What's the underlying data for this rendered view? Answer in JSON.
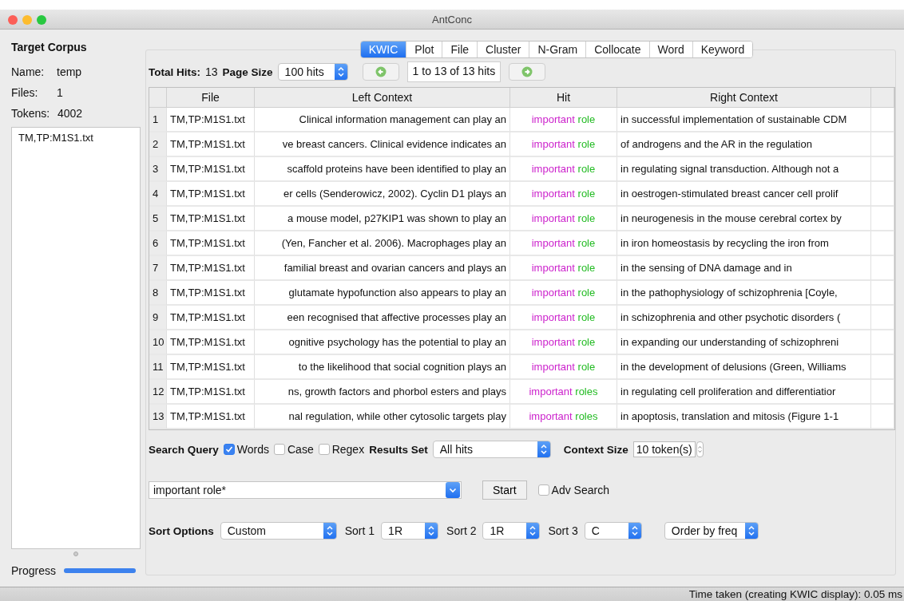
{
  "window": {
    "title": "AntConc"
  },
  "sidebar": {
    "heading": "Target Corpus",
    "stats": [
      {
        "label": "Name:",
        "value": "temp"
      },
      {
        "label": "Files:",
        "value": "1"
      },
      {
        "label": "Tokens:",
        "value": "4002"
      }
    ],
    "files": [
      {
        "name": "TM,TP:M1S1.txt",
        "selected": false
      }
    ],
    "progress": {
      "label": "Progress",
      "level": 1
    }
  },
  "tabs": [
    {
      "label": "KWIC",
      "selected": true
    },
    {
      "label": "Plot",
      "selected": false
    },
    {
      "label": "File",
      "selected": false
    },
    {
      "label": "Cluster",
      "selected": false
    },
    {
      "label": "N-Gram",
      "selected": false
    },
    {
      "label": "Collocate",
      "selected": false
    },
    {
      "label": "Word",
      "selected": false
    },
    {
      "label": "Keyword",
      "selected": false
    }
  ],
  "toolbar": {
    "total_hits_label": "Total Hits:",
    "total_hits": "13",
    "page_size_label": "Page Size",
    "page_size": "100 hits",
    "range": "1 to 13 of 13 hits"
  },
  "table": {
    "columns": [
      "File",
      "Left Context",
      "Hit",
      "Right Context"
    ],
    "rows": [
      {
        "number": "1",
        "file": "TM,TP:M1S1.txt",
        "left": "Clinical information management can play an",
        "hit": [
          {
            "text": "important",
            "color": "#cc22cc"
          },
          {
            "text": "role",
            "color": "#22bb22"
          }
        ],
        "right": "in successful implementation of sustainable CDM"
      },
      {
        "number": "2",
        "file": "TM,TP:M1S1.txt",
        "left": "ve breast cancers. Clinical evidence indicates an",
        "hit": [
          {
            "text": "important",
            "color": "#cc22cc"
          },
          {
            "text": "role",
            "color": "#22bb22"
          }
        ],
        "right": "of androgens and the AR in the regulation"
      },
      {
        "number": "3",
        "file": "TM,TP:M1S1.txt",
        "left": "scaffold proteins have been identified to play an",
        "hit": [
          {
            "text": "important",
            "color": "#cc22cc"
          },
          {
            "text": "role",
            "color": "#22bb22"
          }
        ],
        "right": "in regulating signal transduction. Although not a"
      },
      {
        "number": "4",
        "file": "TM,TP:M1S1.txt",
        "left": "er cells (Senderowicz, 2002). Cyclin D1 plays an",
        "hit": [
          {
            "text": "important",
            "color": "#cc22cc"
          },
          {
            "text": "role",
            "color": "#22bb22"
          }
        ],
        "right": "in oestrogen-stimulated breast cancer cell prolif"
      },
      {
        "number": "5",
        "file": "TM,TP:M1S1.txt",
        "left": "a mouse model, p27KIP1 was shown to play an",
        "hit": [
          {
            "text": "important",
            "color": "#cc22cc"
          },
          {
            "text": "role",
            "color": "#22bb22"
          }
        ],
        "right": "in neurogenesis in the mouse cerebral cortex by"
      },
      {
        "number": "6",
        "file": "TM,TP:M1S1.txt",
        "left": "(Yen, Fancher et al. 2006). Macrophages play an",
        "hit": [
          {
            "text": "important",
            "color": "#cc22cc"
          },
          {
            "text": "role",
            "color": "#22bb22"
          }
        ],
        "right": "in iron homeostasis by recycling the iron from"
      },
      {
        "number": "7",
        "file": "TM,TP:M1S1.txt",
        "left": "familial breast and ovarian cancers and plays an",
        "hit": [
          {
            "text": "important",
            "color": "#cc22cc"
          },
          {
            "text": "role",
            "color": "#22bb22"
          }
        ],
        "right": "in the sensing of DNA damage and in"
      },
      {
        "number": "8",
        "file": "TM,TP:M1S1.txt",
        "left": "glutamate hypofunction also appears to play an",
        "hit": [
          {
            "text": "important",
            "color": "#cc22cc"
          },
          {
            "text": "role",
            "color": "#22bb22"
          }
        ],
        "right": "in the pathophysiology of schizophrenia [Coyle,"
      },
      {
        "number": "9",
        "file": "TM,TP:M1S1.txt",
        "left": "een recognised that affective processes play an",
        "hit": [
          {
            "text": "important",
            "color": "#cc22cc"
          },
          {
            "text": "role",
            "color": "#22bb22"
          }
        ],
        "right": "in schizophrenia and other psychotic disorders ("
      },
      {
        "number": "10",
        "file": "TM,TP:M1S1.txt",
        "left": "ognitive psychology has the potential to play an",
        "hit": [
          {
            "text": "important",
            "color": "#cc22cc"
          },
          {
            "text": "role",
            "color": "#22bb22"
          }
        ],
        "right": "in expanding our understanding of schizophreni"
      },
      {
        "number": "11",
        "file": "TM,TP:M1S1.txt",
        "left": "to the likelihood that social cognition plays an",
        "hit": [
          {
            "text": "important",
            "color": "#cc22cc"
          },
          {
            "text": "role",
            "color": "#22bb22"
          }
        ],
        "right": "in the development of delusions (Green, Williams"
      },
      {
        "number": "12",
        "file": "TM,TP:M1S1.txt",
        "left": "ns, growth factors and phorbol esters and plays",
        "hit": [
          {
            "text": "important",
            "color": "#cc22cc"
          },
          {
            "text": "roles",
            "color": "#22bb22"
          }
        ],
        "right": "in regulating cell proliferation and differentiatior"
      },
      {
        "number": "13",
        "file": "TM,TP:M1S1.txt",
        "left": "nal regulation, while other cytosolic targets play",
        "hit": [
          {
            "text": "important",
            "color": "#cc22cc"
          },
          {
            "text": "roles",
            "color": "#22bb22"
          }
        ],
        "right": "in apoptosis, translation and mitosis (Figure 1-1"
      }
    ]
  },
  "search": {
    "label": "Search Query",
    "options": [
      {
        "label": "Words",
        "checked": true
      },
      {
        "label": "Case",
        "checked": false
      },
      {
        "label": "Regex",
        "checked": false
      }
    ],
    "results_set_label": "Results Set",
    "results_set": "All hits",
    "context_size_label": "Context Size",
    "context_size": "10 token(s)",
    "query": "important role*",
    "start": "Start",
    "adv_search": {
      "label": "Adv Search",
      "checked": false
    }
  },
  "sort": {
    "label": "Sort Options",
    "mode": "Custom",
    "levels": [
      {
        "label": "Sort 1",
        "value": "1R"
      },
      {
        "label": "Sort 2",
        "value": "1R"
      },
      {
        "label": "Sort 3",
        "value": "C"
      }
    ],
    "order": "Order by freq"
  },
  "status_bar": "Time taken (creating KWIC display): 0.05 ms"
}
